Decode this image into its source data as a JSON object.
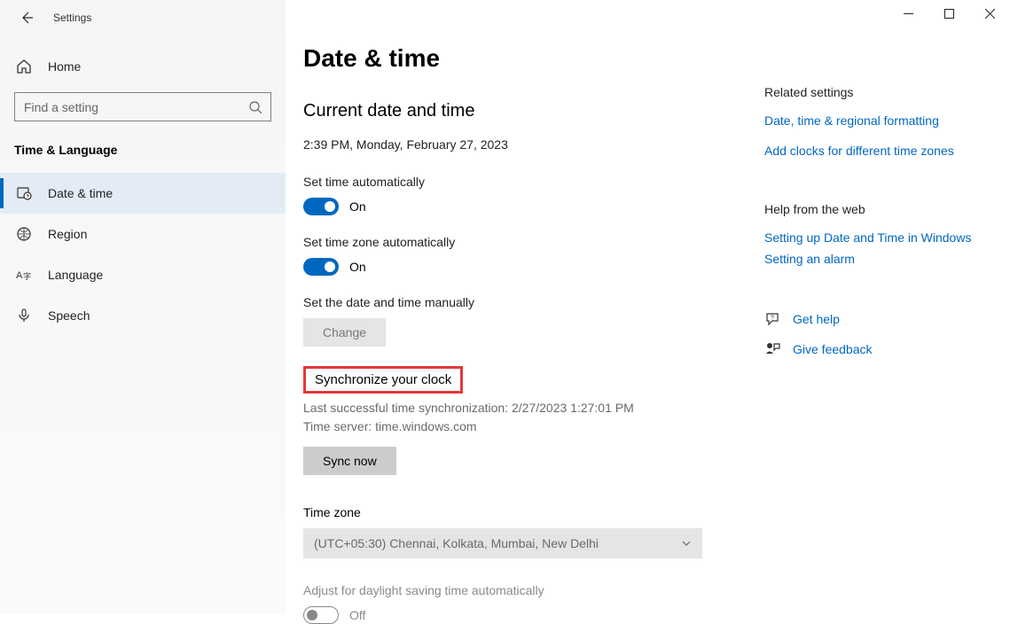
{
  "app": {
    "title": "Settings"
  },
  "sidebar": {
    "home_label": "Home",
    "search_placeholder": "Find a setting",
    "category_label": "Time & Language",
    "items": [
      {
        "label": "Date & time"
      },
      {
        "label": "Region"
      },
      {
        "label": "Language"
      },
      {
        "label": "Speech"
      }
    ]
  },
  "main": {
    "title": "Date & time",
    "current_heading": "Current date and time",
    "current_value": "2:39 PM, Monday, February 27, 2023",
    "auto_time_label": "Set time automatically",
    "auto_time_state": "On",
    "auto_tz_label": "Set time zone automatically",
    "auto_tz_state": "On",
    "manual_label": "Set the date and time manually",
    "change_btn": "Change",
    "sync_heading": "Synchronize your clock",
    "sync_last": "Last successful time synchronization: 2/27/2023 1:27:01 PM",
    "sync_server": "Time server: time.windows.com",
    "sync_btn": "Sync now",
    "tz_label": "Time zone",
    "tz_value": "(UTC+05:30) Chennai, Kolkata, Mumbai, New Delhi",
    "dst_label": "Adjust for daylight saving time automatically",
    "dst_state": "Off"
  },
  "aside": {
    "related_heading": "Related settings",
    "related_links": [
      "Date, time & regional formatting",
      "Add clocks for different time zones"
    ],
    "help_heading": "Help from the web",
    "help_links": [
      "Setting up Date and Time in Windows",
      "Setting an alarm"
    ],
    "get_help": "Get help",
    "feedback": "Give feedback"
  }
}
